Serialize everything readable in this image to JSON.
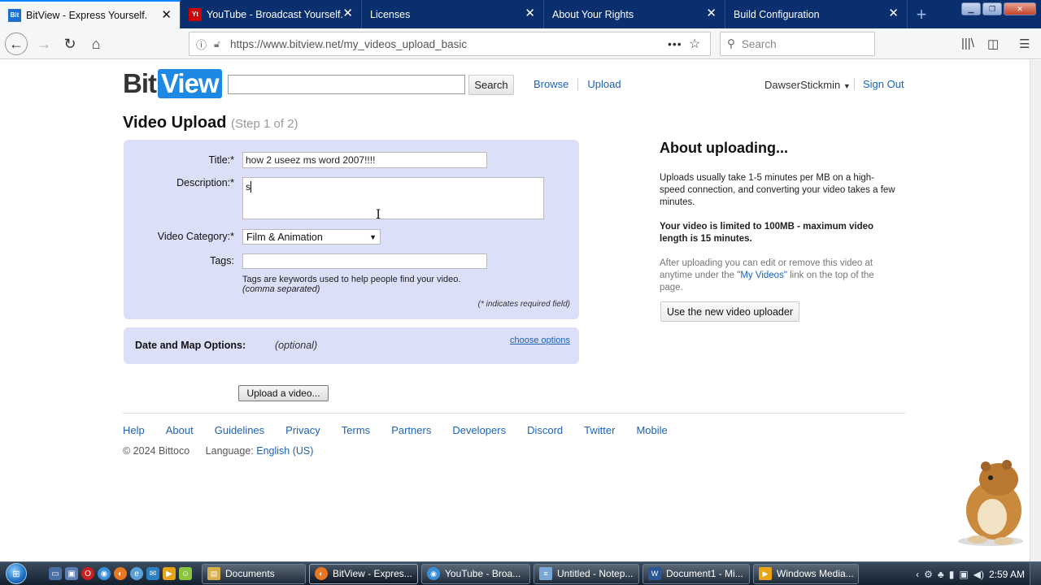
{
  "browser": {
    "tabs": [
      {
        "label": "BitView - Express Yourself.",
        "favicon": "bitview-icon",
        "active": true
      },
      {
        "label": "YouTube - Broadcast Yourself.",
        "favicon": "youtube-icon",
        "active": false
      },
      {
        "label": "Licenses",
        "favicon": "",
        "active": false
      },
      {
        "label": "About Your Rights",
        "favicon": "",
        "active": false
      },
      {
        "label": "Build Configuration",
        "favicon": "",
        "active": false
      }
    ],
    "url": "https://www.bitview.net/my_videos_upload_basic",
    "search_placeholder": "Search"
  },
  "site": {
    "logo_bit": "Bit",
    "logo_view": "View",
    "search_button": "Search",
    "nav": [
      "Browse",
      "Upload"
    ],
    "username": "DawserStickmin",
    "signout": "Sign Out"
  },
  "upload": {
    "title": "Video Upload",
    "step": "(Step 1 of 2)",
    "title_label": "Title:*",
    "title_value": "how 2 useez ms word 2007!!!!",
    "description_label": "Description:*",
    "description_value": "s",
    "category_label": "Video Category:*",
    "category_value": "Film & Animation",
    "tags_label": "Tags:",
    "tags_value": "",
    "tags_hint": "Tags are keywords used to help people find your video.",
    "tags_hint2": "(comma separated)",
    "required_note": "(* indicates required field)",
    "date_label": "Date and Map Options:",
    "date_optional": "(optional)",
    "choose_options": "choose options",
    "upload_button": "Upload a video..."
  },
  "about": {
    "heading": "About uploading...",
    "p1": "Uploads usually take 1-5 minutes per MB on a high-speed connection, and converting your video takes a few minutes.",
    "p2": "Your video is limited to 100MB - maximum video length is 15 minutes.",
    "p3a": "After uploading you can edit or remove this video at anytime under the ",
    "p3link": "\"My Videos\"",
    "p3b": " link on the top of the page.",
    "new_uploader": "Use the new video uploader"
  },
  "footer": {
    "links": [
      "Help",
      "About",
      "Guidelines",
      "Privacy",
      "Terms",
      "Partners",
      "Developers",
      "Discord",
      "Twitter",
      "Mobile"
    ],
    "copyright": "© 2024 Bittoco",
    "language_label": "Language:",
    "language_value": "English (US)"
  },
  "taskbar": {
    "tasks": [
      {
        "label": "Documents",
        "icon": "folder-icon",
        "color": "#d6b04a"
      },
      {
        "label": "BitView - Expres...",
        "icon": "firefox-icon",
        "color": "#e87722",
        "active": true
      },
      {
        "label": "YouTube - Broa...",
        "icon": "chrome-icon",
        "color": "#3b8fd9"
      },
      {
        "label": "Untitled - Notep...",
        "icon": "notepad-icon",
        "color": "#7aa7d6"
      },
      {
        "label": "Document1 - Mi...",
        "icon": "word-icon",
        "color": "#2b5797"
      },
      {
        "label": "Windows Media...",
        "icon": "media-player-icon",
        "color": "#e8a317"
      }
    ],
    "clock": "2:59 AM"
  }
}
